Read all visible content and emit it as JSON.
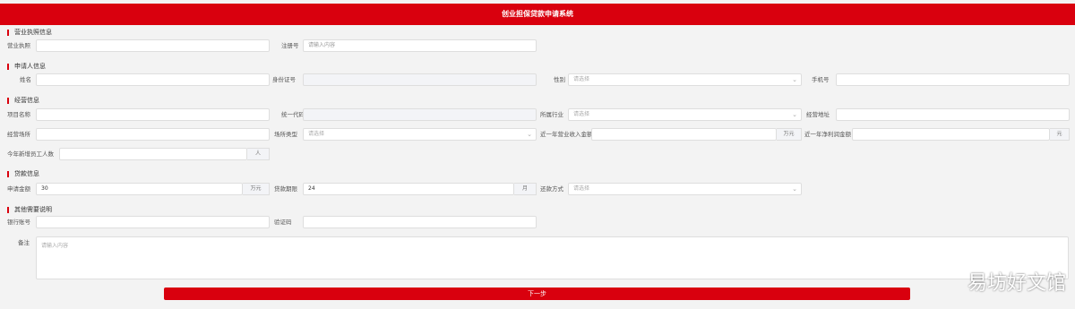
{
  "header": {
    "title": "创业担保贷款申请系统"
  },
  "sec1": {
    "title": "营业执照信息",
    "license_label": "营业执照",
    "license_value": "",
    "reg_label": "注册号",
    "reg_placeholder": "请输入内容"
  },
  "sec2": {
    "title": "申请人信息",
    "name_label": "姓名",
    "idcard_label": "身份证号",
    "gender_label": "性别",
    "gender_placeholder": "请选择",
    "phone_label": "手机号"
  },
  "sec3": {
    "title": "经营信息",
    "project_label": "项目名称",
    "credit_label": "统一代码",
    "industry_label": "所属行业",
    "industry_placeholder": "请选择",
    "address_label": "经营地址",
    "place_label": "经营场所",
    "type_label": "场所类型",
    "type_placeholder": "请选择",
    "income_label": "近一年营业收入金额",
    "income_suffix": "万元",
    "profit_label": "近一年净利润金额",
    "profit_suffix": "元",
    "staff_label": "今年新增员工人数",
    "staff_suffix": "人"
  },
  "sec4": {
    "title": "贷款信息",
    "amount_label": "申请金额",
    "amount_value": "30",
    "amount_suffix": "万元",
    "term_label": "贷款期限",
    "term_value": "24",
    "term_suffix": "月",
    "repay_label": "还款方式",
    "repay_placeholder": "请选择"
  },
  "sec5": {
    "title": "其他需要说明",
    "bank_label": "银行账号",
    "code_label": "验证码",
    "note_label": "备注",
    "note_placeholder": "请输入内容"
  },
  "submit": {
    "label": "下一步"
  },
  "watermark": "易坊好文馆",
  "colors": {
    "brand": "#d9000e",
    "bg": "#f3f3f3"
  }
}
